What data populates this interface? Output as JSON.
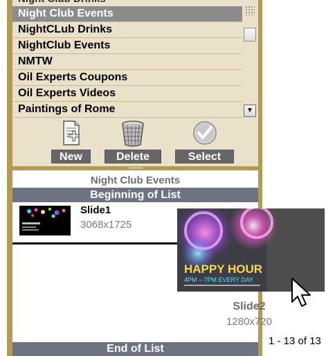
{
  "folder_list": {
    "items": [
      {
        "label": "Night Club Drinks",
        "selected": false
      },
      {
        "label": "Night Club Events",
        "selected": true
      },
      {
        "label": "NightCLub Drinks",
        "selected": false
      },
      {
        "label": "NightClub Events",
        "selected": false
      },
      {
        "label": "NMTW",
        "selected": false
      },
      {
        "label": "Oil Experts Coupons",
        "selected": false
      },
      {
        "label": "Oil Experts Videos",
        "selected": false
      },
      {
        "label": "Paintings of Rome",
        "selected": false
      }
    ]
  },
  "toolbar": {
    "new_label": "New",
    "delete_label": "Delete",
    "select_label": "Select"
  },
  "slides_panel": {
    "folder_title": "Night Club Events",
    "begin_label": "Beginning of List",
    "end_label": "End of List",
    "slides": [
      {
        "name": "Slide1",
        "size": "3068x1725"
      },
      {
        "name": "Slide2",
        "size": "1280x720"
      }
    ],
    "drag_preview": {
      "headline": "HAPPY HOUR",
      "subline": "4PM – 7PM EVERY DAY"
    },
    "count": "1 - 13 of 13"
  },
  "colors": {
    "gold": "#b59a52",
    "list_bg": "#e9e1c9",
    "selected_row": "#8c8c8c",
    "bar": "#6e7382",
    "button": "#666666"
  }
}
